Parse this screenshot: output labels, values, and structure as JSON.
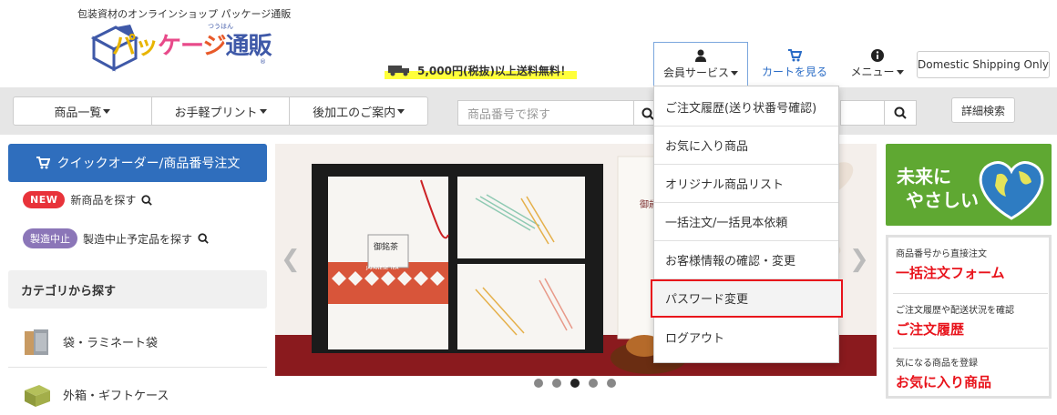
{
  "header": {
    "tagline": "包装資材のオンラインショップ パッケージ通販",
    "logo": {
      "text_a": "パッ",
      "text_b": "ケー",
      "text_c": "ジ",
      "text_d": "通販",
      "ruby": "つうはん"
    },
    "shipping_text": "5,000円(税抜)以上送料無料！",
    "member_label": "会員サービス",
    "cart_label": "カートを見る",
    "menu_label": "メニュー",
    "domestic_label": "Domestic Shipping Only",
    "colors": {
      "accent_blue": "#2f6ebd",
      "highlight": "#ffff3a",
      "alert_red": "#e8131b"
    }
  },
  "nav": {
    "items": [
      {
        "label": "商品一覧"
      },
      {
        "label": "お手軽プリント"
      },
      {
        "label": "後加工のご案内"
      }
    ],
    "search_placeholder": "商品番号で探す",
    "detail_search": "詳細検索"
  },
  "left": {
    "quick_order": "クイックオーダー/商品番号注文",
    "new_badge": "NEW",
    "new_text": "新商品を探す",
    "stop_badge": "製造中止",
    "stop_text": "製造中止予定品を探す",
    "category_heading": "カテゴリから探す",
    "categories": [
      {
        "label": "袋・ラミネート袋"
      },
      {
        "label": "外箱・ギフトケース"
      }
    ]
  },
  "carousel": {
    "box_label_a": "御銘茶",
    "box_label_b": "JAPANESE TEA",
    "dots_count": 5,
    "active_dot": 3
  },
  "dropdown": {
    "items": [
      {
        "label": "ご注文履歴(送り状番号確認)"
      },
      {
        "label": "お気に入り商品"
      },
      {
        "label": "オリジナル商品リスト"
      },
      {
        "label": "一括注文/一括見本依頼"
      },
      {
        "label": "お客様情報の確認・変更"
      },
      {
        "label": "パスワード変更",
        "selected": true
      },
      {
        "label": "ログアウト"
      }
    ]
  },
  "right": {
    "eco_text_a": "未来に",
    "eco_text_b": "やさしい",
    "quick_links": [
      {
        "small": "商品番号から直接注文",
        "big": "一括注文フォーム"
      },
      {
        "small": "ご注文履歴や配送状況を確認",
        "big": "ご注文履歴"
      },
      {
        "small": "気になる商品を登録",
        "big": "お気に入り商品"
      }
    ]
  }
}
